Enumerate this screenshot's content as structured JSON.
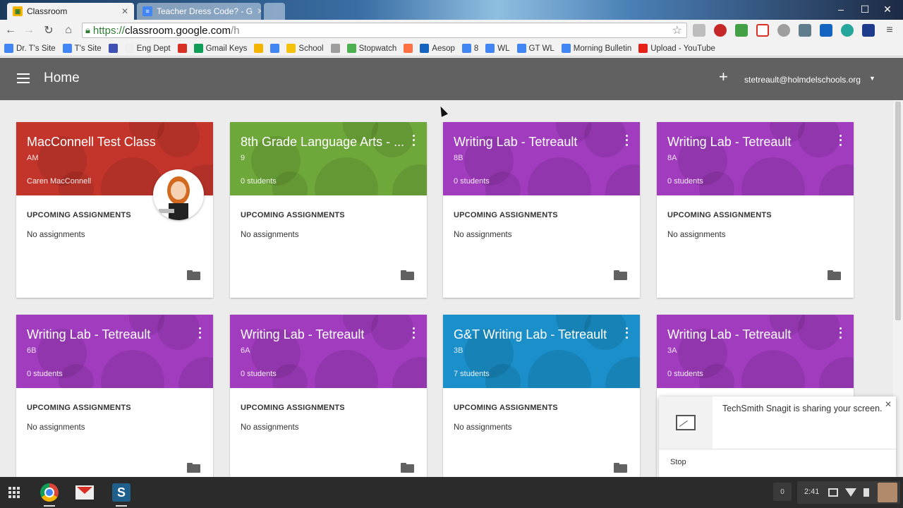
{
  "browser": {
    "tabs": [
      {
        "title": "Classroom",
        "active": true,
        "favicon": "classroom-favicon"
      },
      {
        "title": "Teacher Dress Code? - G",
        "active": false,
        "favicon": "docs-favicon"
      },
      {
        "title": "",
        "active": false,
        "favicon": "new-tab"
      }
    ],
    "address": {
      "scheme": "https://",
      "host": "classroom.google.com",
      "path": "/h"
    },
    "bookmarks": [
      {
        "label": "Dr. T's Site",
        "color": "#4285f4"
      },
      {
        "label": "T's Site",
        "color": "#4285f4"
      },
      {
        "label": "",
        "color": "#3f51b5"
      },
      {
        "label": "Eng Dept",
        "color": "#eeeeee"
      },
      {
        "label": "",
        "color": "#d93025"
      },
      {
        "label": "Gmail Keys",
        "color": "#0f9d58"
      },
      {
        "label": "",
        "color": "#f4b400"
      },
      {
        "label": "",
        "color": "#4285f4"
      },
      {
        "label": "School",
        "color": "#f4c20d"
      },
      {
        "label": "",
        "color": "#9e9e9e"
      },
      {
        "label": "Stopwatch",
        "color": "#4caf50"
      },
      {
        "label": "",
        "color": "#ff7043"
      },
      {
        "label": "Aesop",
        "color": "#1565c0"
      },
      {
        "label": "8",
        "color": "#4285f4"
      },
      {
        "label": "WL",
        "color": "#4285f4"
      },
      {
        "label": "GT WL",
        "color": "#4285f4"
      },
      {
        "label": "Morning Bulletin",
        "color": "#4285f4"
      },
      {
        "label": "Upload - YouTube",
        "color": "#e62117"
      }
    ]
  },
  "appbar": {
    "title": "Home",
    "account": "stetreault@holmdelschools.org"
  },
  "labels": {
    "upcoming": "UPCOMING ASSIGNMENTS",
    "no_assignments": "No assignments"
  },
  "cards": [
    {
      "title": "MacConnell Test Class",
      "section": "AM",
      "meta": "Caren MacConnell",
      "color": "#c3352b",
      "has_menu": false,
      "has_avatar": true
    },
    {
      "title": "8th Grade Language Arts - ...",
      "section": "9",
      "meta": "0 students",
      "color": "#6ea83a",
      "has_menu": true,
      "has_avatar": false
    },
    {
      "title": "Writing Lab - Tetreault",
      "section": "8B",
      "meta": "0 students",
      "color": "#a13cbf",
      "has_menu": true,
      "has_avatar": false
    },
    {
      "title": "Writing Lab - Tetreault",
      "section": "8A",
      "meta": "0 students",
      "color": "#a13cbf",
      "has_menu": true,
      "has_avatar": false
    },
    {
      "title": "Writing Lab - Tetreault",
      "section": "6B",
      "meta": "0 students",
      "color": "#a13cbf",
      "has_menu": true,
      "has_avatar": false
    },
    {
      "title": "Writing Lab - Tetreault",
      "section": "6A",
      "meta": "0 students",
      "color": "#a13cbf",
      "has_menu": true,
      "has_avatar": false
    },
    {
      "title": "G&T Writing Lab - Tetreault",
      "section": "3B",
      "meta": "7 students",
      "color": "#1a8fc9",
      "has_menu": true,
      "has_avatar": false
    },
    {
      "title": "Writing Lab - Tetreault",
      "section": "3A",
      "meta": "0 students",
      "color": "#a13cbf",
      "has_menu": true,
      "has_avatar": false
    }
  ],
  "notification": {
    "text": "TechSmith Snagit is sharing your screen.",
    "action": "Stop"
  },
  "shelf": {
    "notification_count": "0",
    "time": "2:41"
  }
}
